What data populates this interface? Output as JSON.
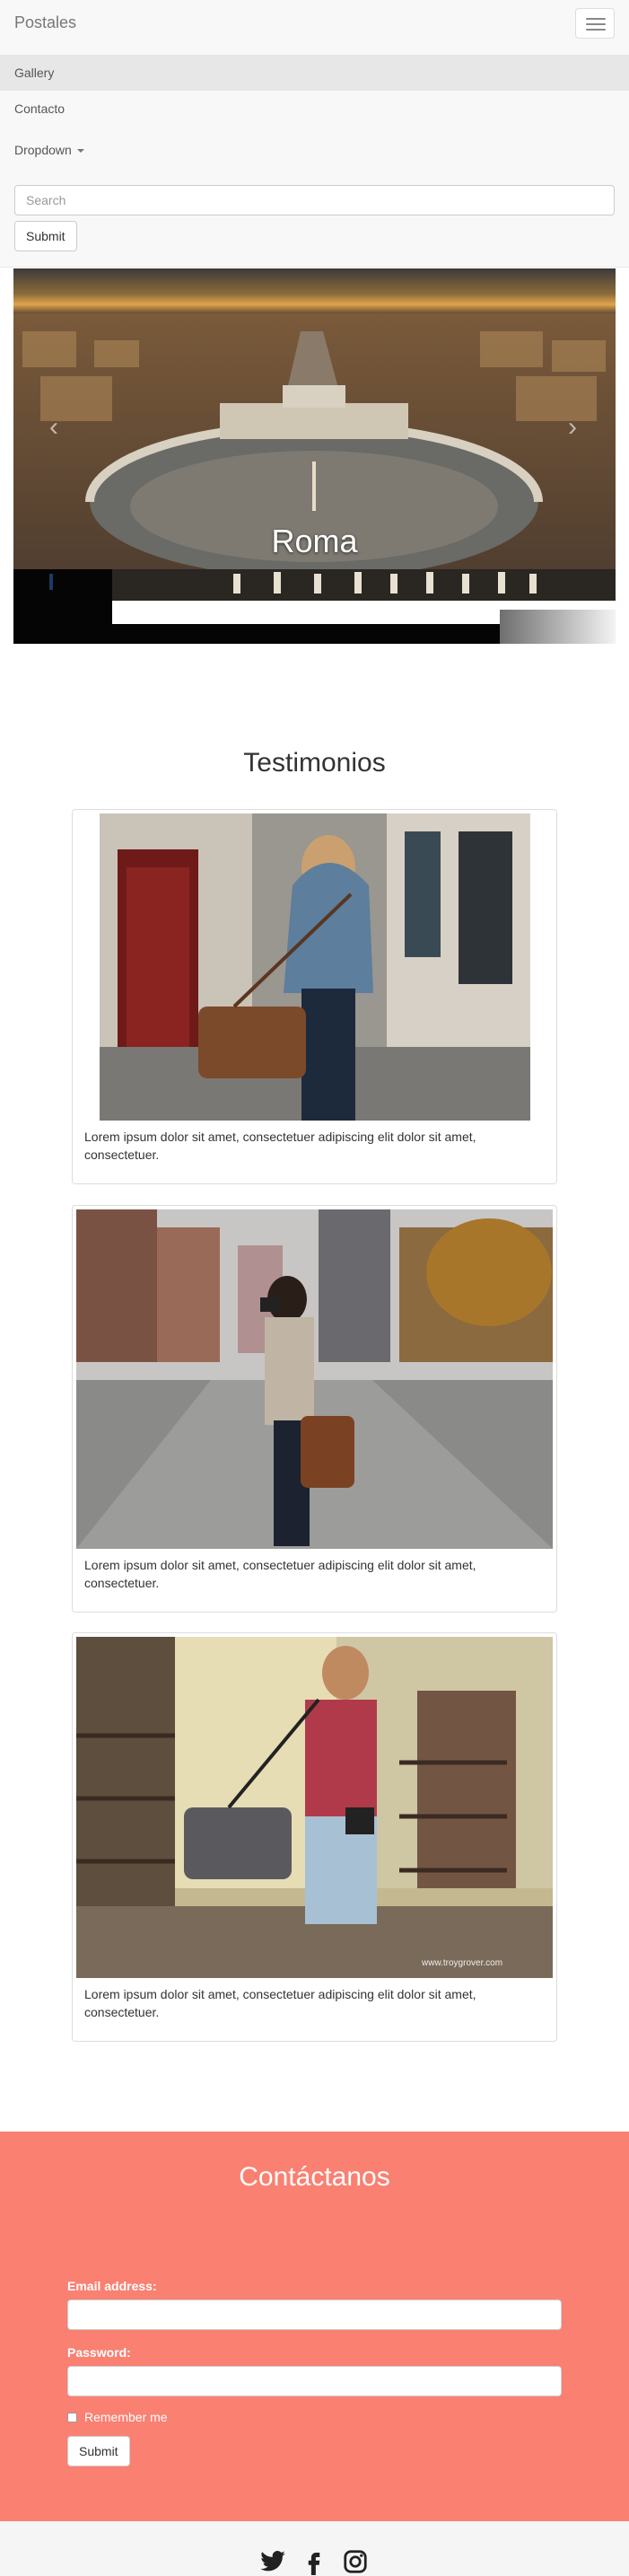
{
  "navbar": {
    "brand": "Postales",
    "items": [
      {
        "label": "Gallery",
        "active": true
      },
      {
        "label": "Contacto",
        "active": false
      }
    ],
    "dropdown_label": "Dropdown",
    "search_placeholder": "Search",
    "submit_label": "Submit"
  },
  "carousel": {
    "caption": "Roma",
    "prev_glyph": "‹",
    "next_glyph": "›"
  },
  "testimonials": {
    "title": "Testimonios",
    "cards": [
      {
        "text": "Lorem ipsum dolor sit amet, consectetuer adipiscing elit dolor sit amet, consectetuer."
      },
      {
        "text": "Lorem ipsum dolor sit amet, consectetuer adipiscing elit dolor sit amet, consectetuer."
      },
      {
        "text": "Lorem ipsum dolor sit amet, consectetuer adipiscing elit dolor sit amet, consectetuer.",
        "watermark": "www.troygrover.com"
      }
    ]
  },
  "contact": {
    "title": "Contáctanos",
    "email_label": "Email address:",
    "password_label": "Password:",
    "remember_label": "Remember me",
    "submit_label": "Submit",
    "background": "#fa8072"
  },
  "footer": {
    "icons": [
      "twitter-icon",
      "facebook-icon",
      "instagram-icon"
    ]
  }
}
